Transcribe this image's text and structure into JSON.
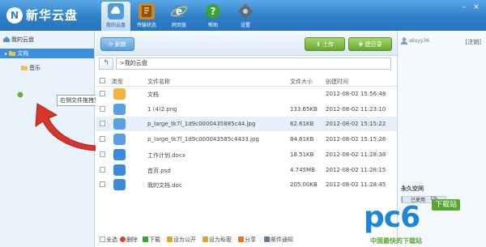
{
  "app": {
    "title": "新华云盘"
  },
  "nav": [
    {
      "label": "我的云盘",
      "icon": "cloud-icon",
      "color": "#4a9be0"
    },
    {
      "label": "传输状态",
      "icon": "transfer-icon",
      "color": "#c98b2a"
    },
    {
      "label": "网页版",
      "icon": "ie-icon",
      "color": "#3f8fd6"
    },
    {
      "label": "帮助",
      "icon": "help-icon",
      "color": "#3aa335"
    },
    {
      "label": "设置",
      "icon": "settings-icon",
      "color": "#606a74"
    }
  ],
  "window_controls": {
    "minimize": "–",
    "close": "×"
  },
  "tree": {
    "root": "我的云盘",
    "docs": "文档",
    "music": "音乐"
  },
  "tooltip": "右侧文件拖拽到此处可转移文件",
  "toolbar": {
    "refresh": "刷新",
    "upload": "上传",
    "new_folder": "建目录"
  },
  "breadcrumb": ">我的云盘",
  "columns": {
    "type": "类型",
    "name": "文件名称",
    "size": "文件大小",
    "time": "创建时间"
  },
  "files": [
    {
      "name": "文档",
      "size": "",
      "time": "2012-08-02 15:56:48",
      "icon_color": "#f2b43a",
      "kind": "folder"
    },
    {
      "name": "1 (4)2.png",
      "size": "133.65KB",
      "time": "2012-08-02 11:23:10",
      "icon_color": "#5aa0e0",
      "kind": "image"
    },
    {
      "name": "p_large_tk7l_1d9c0000435885c44.jpg",
      "size": "62.61KB",
      "time": "2012-08-02 15:15:22",
      "icon_color": "#5aa0e0",
      "kind": "image"
    },
    {
      "name": "p_large_tk7l_1d9c000043585c4433.jpg",
      "size": "84.61KB",
      "time": "2012-08-02 15:15:26",
      "icon_color": "#5aa0e0",
      "kind": "image"
    },
    {
      "name": "工作计划.docx",
      "size": "18.51KB",
      "time": "2012-08-02 11:28:38",
      "icon_color": "#3d8bd8",
      "kind": "doc"
    },
    {
      "name": "首页.psd",
      "size": "4.745MB",
      "time": "2012-08-02 11:28:15",
      "icon_color": "#3d8bd8",
      "kind": "doc"
    },
    {
      "name": "我的文档.doc",
      "size": "205.00KB",
      "time": "2012-08-02 11:28:45",
      "icon_color": "#3d8bd8",
      "kind": "doc"
    }
  ],
  "bottom_actions": [
    {
      "label": "全选",
      "icon": "checkbox-icon",
      "color": "#ffffff"
    },
    {
      "label": "删除",
      "icon": "delete-icon",
      "color": "#d9432f"
    },
    {
      "label": "下载",
      "icon": "download-icon",
      "color": "#3aa335"
    },
    {
      "label": "设为公开",
      "icon": "key-icon",
      "color": "#d9a52a"
    },
    {
      "label": "设为私密",
      "icon": "lock-icon",
      "color": "#d9a52a"
    },
    {
      "label": "分享",
      "icon": "share-icon",
      "color": "#d97b2a"
    },
    {
      "label": "邮件通知",
      "icon": "mail-icon",
      "color": "#6a7a8a"
    }
  ],
  "account": {
    "user": "aksyy36",
    "logout": "[注销]",
    "space_title": "永久空间",
    "used_label": "已使用",
    "used_value": "1%",
    "used_fraction": 0.01
  },
  "watermark": {
    "brand": "pc6",
    "badge": "下载站",
    "tagline": "中国最快的下载站"
  },
  "colors": {
    "titlebar": "#2f7fc9",
    "selected": "#3c8fdb",
    "watermark_blue": "#1d86d6",
    "watermark_green": "#58a634"
  }
}
